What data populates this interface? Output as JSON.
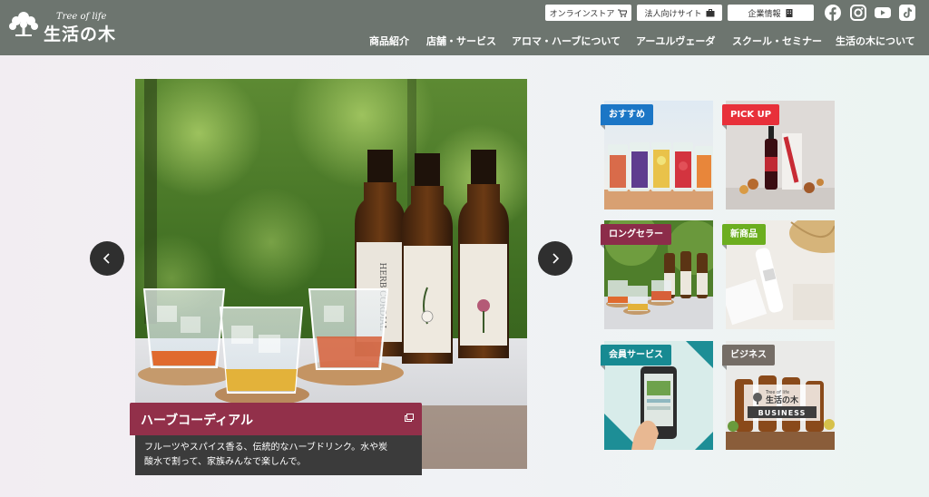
{
  "header": {
    "logo_small": "Tree of life",
    "logo_big": "生活の木",
    "utility": [
      {
        "label": "オンラインストア",
        "icon": "cart-icon"
      },
      {
        "label": "法人向けサイト",
        "icon": "briefcase-icon"
      },
      {
        "label": "企業情報",
        "icon": "building-icon"
      }
    ],
    "social": [
      "facebook-icon",
      "instagram-icon",
      "youtube-icon",
      "tiktok-icon"
    ],
    "nav": [
      "商品紹介",
      "店舗・サービス",
      "アロマ・ハーブについて",
      "アーユルヴェーダ",
      "スクール・セミナー",
      "生活の木について"
    ]
  },
  "hero": {
    "title": "ハーブコーディアル",
    "text_line1": "フルーツやスパイス香る、伝統的なハーブドリンク。水や炭",
    "text_line2": "酸水で割って、家族みんなで楽しんで。",
    "prev_icon": "chevron-left-icon",
    "next_icon": "chevron-right-icon",
    "external_icon": "external-window-icon",
    "bottle_label": "HERB CORDIAL"
  },
  "tiles": [
    {
      "badge": "おすすめ",
      "color": "#1b76c6"
    },
    {
      "badge": "PICK UP",
      "color": "#e8303a"
    },
    {
      "badge": "ロングセラー",
      "color": "#8c2c4a"
    },
    {
      "badge": "新商品",
      "color": "#6cae1f"
    },
    {
      "badge": "会員サービス",
      "color": "#178a92"
    },
    {
      "badge": "ビジネス",
      "color": "#756d66"
    }
  ],
  "business_tile": {
    "logo_small": "Tree of life",
    "logo_big": "生活の木",
    "label": "BUSINESS"
  },
  "colors": {
    "header_bg": "#6d756f",
    "caption_title_bg": "#92304a",
    "caption_text_bg": "#3b3b3b"
  }
}
